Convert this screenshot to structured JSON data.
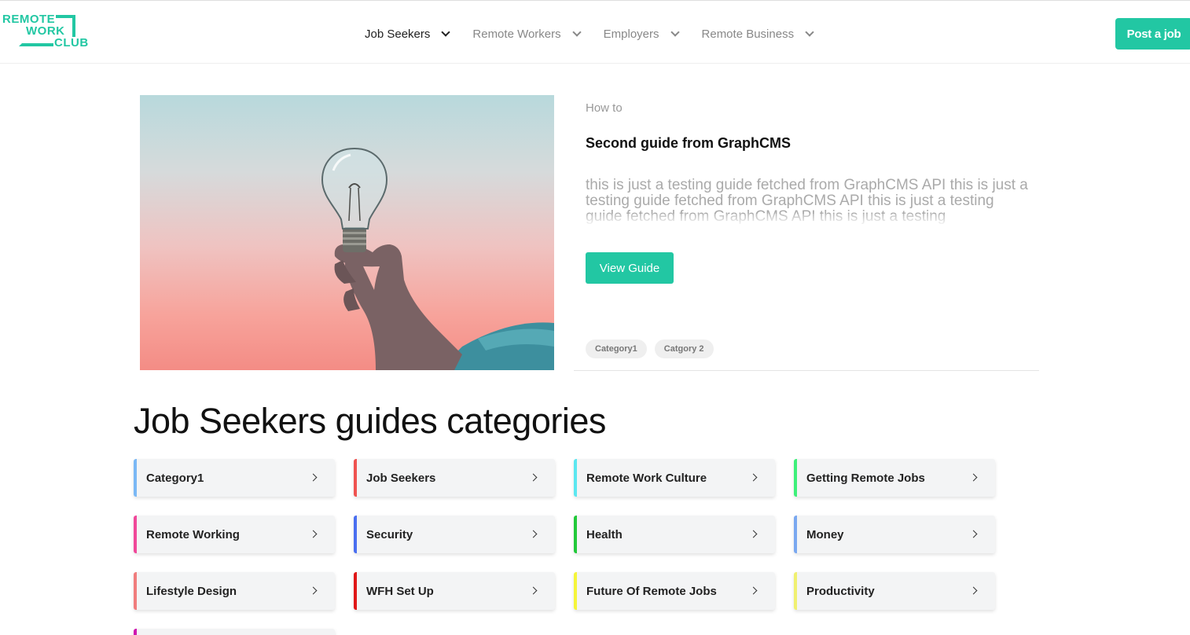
{
  "logo": {
    "line1": "REMOTE",
    "line2": "WORK",
    "line3": "CLUB"
  },
  "nav": {
    "items": [
      {
        "label": "Job Seekers"
      },
      {
        "label": "Remote Workers"
      },
      {
        "label": "Employers"
      },
      {
        "label": "Remote Business"
      }
    ],
    "post_button": "Post a job"
  },
  "featured": {
    "kicker": "How to",
    "title": "Second guide from GraphCMS",
    "description": "this is just a testing guide fetched from GraphCMS API this is just a testing guide fetched from GraphCMS API this is just a testing guide fetched from GraphCMS API this is just a testing",
    "button": "View Guide",
    "tags": [
      "Category1",
      "Catgory 2"
    ]
  },
  "categories": {
    "title": "Job Seekers guides categories",
    "items": [
      {
        "label": "Category1",
        "color": "#7ab8f5"
      },
      {
        "label": "Job Seekers",
        "color": "#ef5350"
      },
      {
        "label": "Remote Work Culture",
        "color": "#5be7f0"
      },
      {
        "label": "Getting Remote Jobs",
        "color": "#3ef07a"
      },
      {
        "label": "Remote Working",
        "color": "#f0489a"
      },
      {
        "label": "Security",
        "color": "#4a6ff0"
      },
      {
        "label": "Health",
        "color": "#22c93a"
      },
      {
        "label": "Money",
        "color": "#7aa8f0"
      },
      {
        "label": "Lifestyle Design",
        "color": "#f07d7d"
      },
      {
        "label": "WFH Set Up",
        "color": "#e01818"
      },
      {
        "label": "Future Of Remote Jobs",
        "color": "#f5f53a"
      },
      {
        "label": "Productivity",
        "color": "#f0f070"
      },
      {
        "label": "",
        "color": "#d018b0"
      }
    ]
  }
}
